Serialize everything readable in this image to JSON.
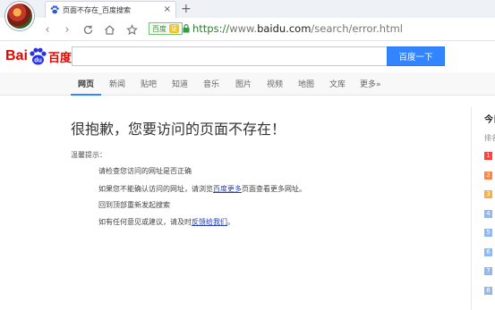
{
  "browser": {
    "tab_title": "页面不存在_百度搜索",
    "tab_close": "×",
    "new_tab": "+",
    "address": {
      "badge_label": "百度",
      "badge_verify": "证",
      "url_scheme": "https://",
      "url_host_prefix": "www.",
      "url_host": "baidu.com",
      "url_path": "/search/error.html"
    }
  },
  "search": {
    "logo_bai": "Bai",
    "logo_cn": "百度",
    "query_value": "",
    "button_label": "百度一下"
  },
  "tabs": [
    {
      "label": "网页",
      "active": true
    },
    {
      "label": "新闻"
    },
    {
      "label": "贴吧"
    },
    {
      "label": "知道"
    },
    {
      "label": "音乐"
    },
    {
      "label": "图片"
    },
    {
      "label": "视频"
    },
    {
      "label": "地图"
    },
    {
      "label": "文库"
    },
    {
      "label": "更多»"
    }
  ],
  "error": {
    "title": "很抱歉，您要访问的页面不存在！",
    "hint_label": "温馨提示：",
    "hints": [
      {
        "text": "请检查您访问的网址是否正确"
      },
      {
        "before": "如果您不能确认访问的网址，请浏览",
        "link": "百度更多",
        "after": "页面查看更多网址。"
      },
      {
        "text": "回到顶部重新发起搜索"
      },
      {
        "before": "如有任何意见或建议，请及时",
        "link": "反馈给我们",
        "after": "。"
      }
    ]
  },
  "right_panel": {
    "title": "今日",
    "subtitle": "排名",
    "ranks": [
      "1",
      "2",
      "3",
      "4",
      "5",
      "6",
      "7",
      "8"
    ],
    "rank_colors": [
      "#f54545",
      "#ff8547",
      "#ffac38",
      "#8eb9f5",
      "#8eb9f5",
      "#8eb9f5",
      "#8eb9f5",
      "#8eb9f5"
    ]
  }
}
